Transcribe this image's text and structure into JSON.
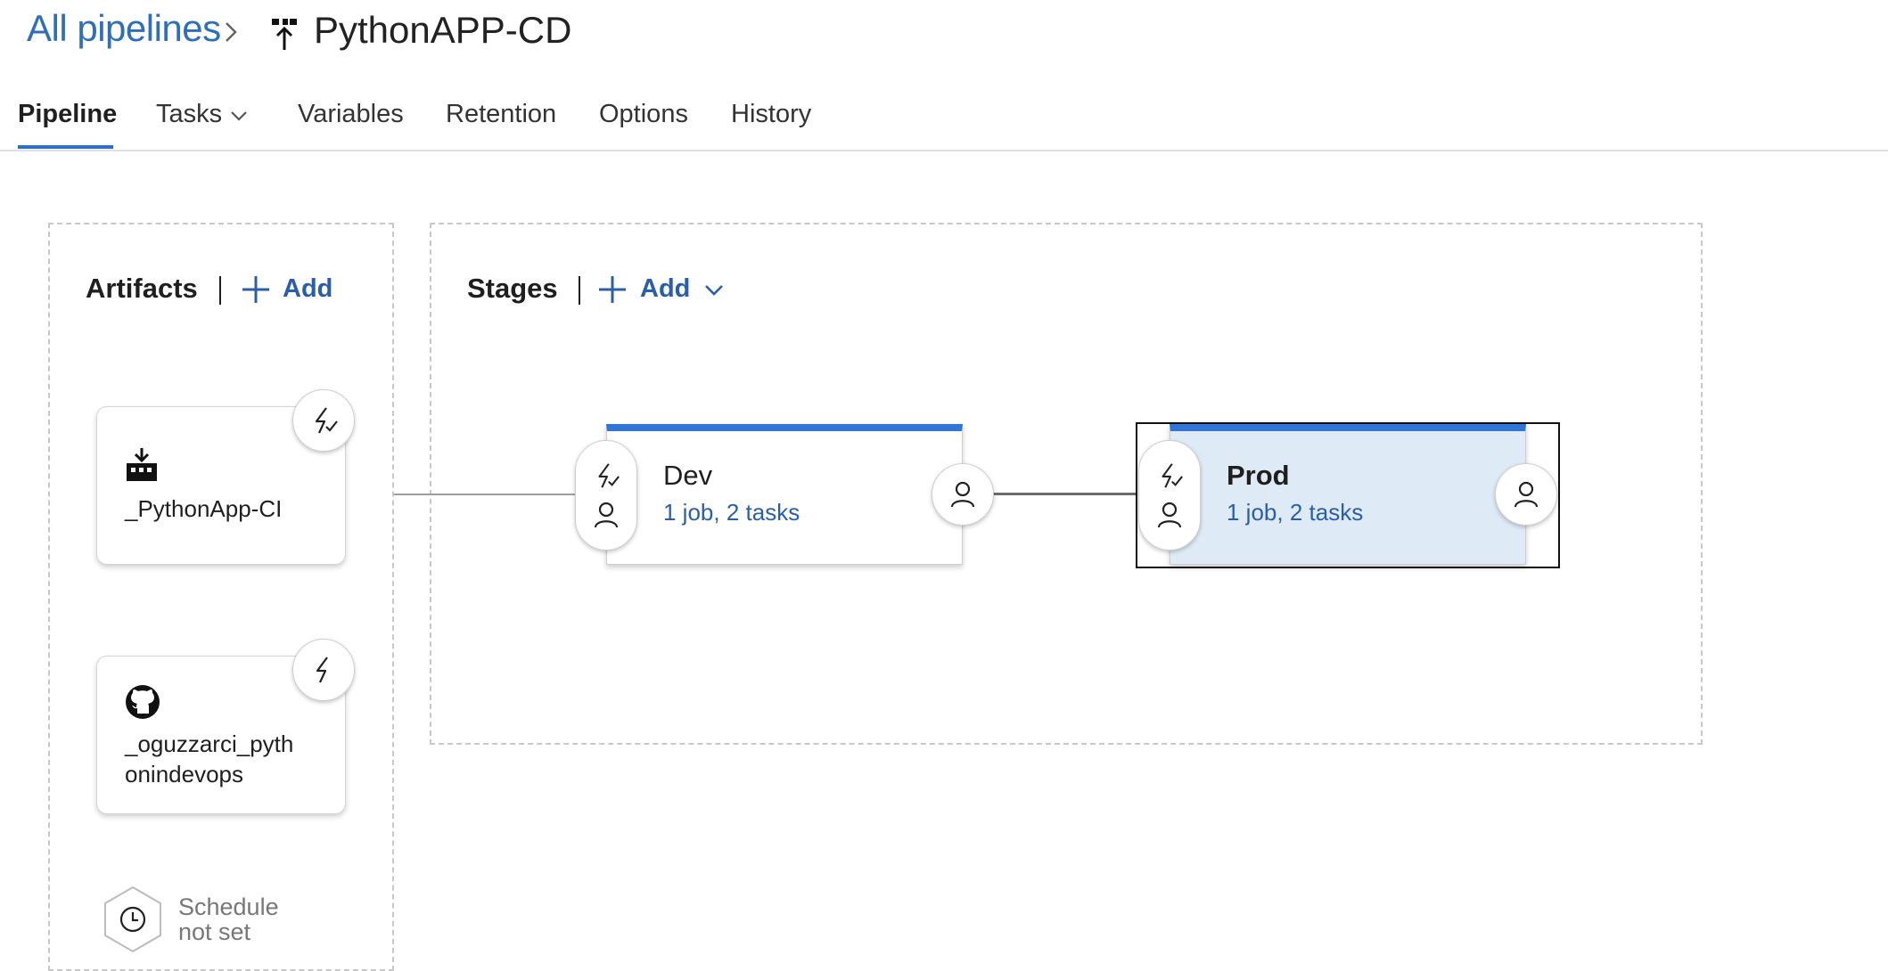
{
  "header": {
    "breadcrumb": "All pipelines",
    "title": "PythonAPP-CD"
  },
  "tabs": [
    {
      "label": "Pipeline"
    },
    {
      "label": "Tasks"
    },
    {
      "label": "Variables"
    },
    {
      "label": "Retention"
    },
    {
      "label": "Options"
    },
    {
      "label": "History"
    }
  ],
  "artifacts": {
    "title": "Artifacts",
    "add_label": "Add",
    "items": [
      {
        "name": "_PythonApp-CI",
        "icon": "build-artifact-icon"
      },
      {
        "name_line1": "_oguzzarci_pyth",
        "name_line2": "onindevops",
        "icon": "github-icon"
      }
    ],
    "schedule_line1": "Schedule",
    "schedule_line2": "not set"
  },
  "stages": {
    "title": "Stages",
    "add_label": "Add",
    "items": [
      {
        "name": "Dev",
        "summary": "1 job, 2 tasks",
        "selected": false
      },
      {
        "name": "Prod",
        "summary": "1 job, 2 tasks",
        "selected": true
      }
    ]
  },
  "colors": {
    "accent": "#2f76d6",
    "link": "#2a5ea8",
    "selected_stage_bg": "#dfeaf7"
  }
}
